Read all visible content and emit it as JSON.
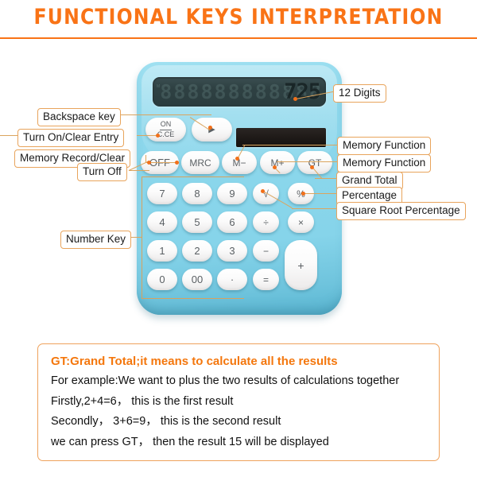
{
  "header": {
    "title": "FUNCTIONAL KEYS INTERPRETATION",
    "accent_color": "#f97316"
  },
  "calculator": {
    "body_color": "#8ed8ec",
    "display": {
      "value": "725",
      "ghost_digit": "8",
      "ghost_count": 12,
      "side_marks": "M"
    },
    "solar_panel": "solar-panel",
    "function_keys_row1": [
      {
        "name": "on-clear-entry-key",
        "top": "ON",
        "bottom": "C.CE"
      },
      {
        "name": "backspace-key",
        "label": "▶"
      }
    ],
    "function_keys_row2": [
      {
        "name": "off-key",
        "label": "OFF"
      },
      {
        "name": "mrc-key",
        "label": "MRC"
      },
      {
        "name": "memory-minus-key",
        "label": "M−"
      },
      {
        "name": "memory-plus-key",
        "label": "M+"
      },
      {
        "name": "grand-total-key",
        "label": "GT"
      }
    ],
    "number_keys": [
      {
        "name": "key-7",
        "label": "7"
      },
      {
        "name": "key-8",
        "label": "8"
      },
      {
        "name": "key-9",
        "label": "9"
      },
      {
        "name": "key-4",
        "label": "4"
      },
      {
        "name": "key-5",
        "label": "5"
      },
      {
        "name": "key-6",
        "label": "6"
      },
      {
        "name": "key-1",
        "label": "1"
      },
      {
        "name": "key-2",
        "label": "2"
      },
      {
        "name": "key-3",
        "label": "3"
      },
      {
        "name": "key-0",
        "label": "0"
      },
      {
        "name": "key-00",
        "label": "00"
      },
      {
        "name": "key-decimal",
        "label": "·"
      }
    ],
    "operator_keys": [
      {
        "name": "square-root-key",
        "label": "√"
      },
      {
        "name": "percent-key",
        "label": "%"
      },
      {
        "name": "divide-key",
        "label": "÷"
      },
      {
        "name": "multiply-key",
        "label": "×"
      },
      {
        "name": "minus-key",
        "label": "−"
      },
      {
        "name": "equals-key",
        "label": "="
      },
      {
        "name": "plus-key",
        "label": "+"
      }
    ]
  },
  "callouts": {
    "left": [
      {
        "name": "callout-backspace",
        "text": "Backspace key"
      },
      {
        "name": "callout-turn-on-clear-entry",
        "text": "Turn On/Clear Entry"
      },
      {
        "name": "callout-memory-record-clear",
        "text": "Memory Record/Clear"
      },
      {
        "name": "callout-turn-off",
        "text": "Turn Off"
      },
      {
        "name": "callout-number-key",
        "text": "Number Key"
      }
    ],
    "right": [
      {
        "name": "callout-12-digits",
        "text": "12 Digits"
      },
      {
        "name": "callout-memory-function-1",
        "text": "Memory Function"
      },
      {
        "name": "callout-memory-function-2",
        "text": "Memory Function"
      },
      {
        "name": "callout-grand-total",
        "text": "Grand Total"
      },
      {
        "name": "callout-percentage",
        "text": "Percentage"
      },
      {
        "name": "callout-square-root-percentage",
        "text": "Square Root Percentage"
      }
    ]
  },
  "explanation": {
    "heading": "GT:Grand Total;it means to calculate all the results",
    "lines": [
      "For example:We want to plus the two  results of calculations together",
      "Firstly,2+4=6， this is the first result",
      "Secondly， 3+6=9， this is the second result",
      "we can press GT， then the result 15 will be displayed"
    ]
  }
}
